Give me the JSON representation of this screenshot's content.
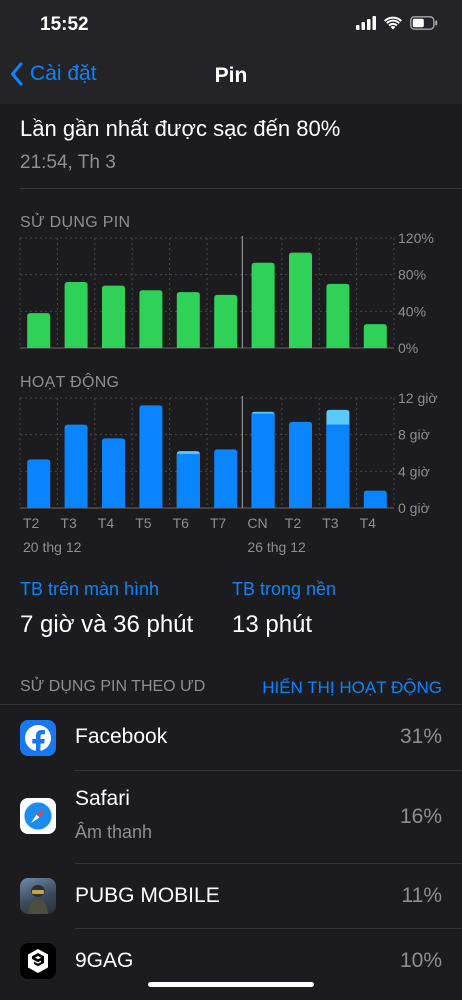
{
  "status_bar": {
    "time": "15:52"
  },
  "nav": {
    "back_label": "Cài đặt",
    "title": "Pin"
  },
  "last_charge": {
    "text": "Lần gần nhất được sạc đến 80%",
    "time": "21:54, Th 3"
  },
  "battery_chart": {
    "label": "SỬ DỤNG PIN",
    "y_ticks": [
      "120%",
      "80%",
      "40%",
      "0%"
    ]
  },
  "activity_chart": {
    "label": "HOẠT ĐỘNG",
    "y_ticks": [
      "12 giờ",
      "8 giờ",
      "4 giờ",
      "0 giờ"
    ]
  },
  "x_axis": {
    "days": [
      "T2",
      "T3",
      "T4",
      "T5",
      "T6",
      "T7",
      "CN",
      "T2",
      "T3",
      "T4"
    ],
    "week_labels": [
      "20 thg 12",
      "26 thg 12"
    ]
  },
  "chart_data": [
    {
      "type": "bar",
      "title": "SỬ DỤNG PIN",
      "categories": [
        "T2",
        "T3",
        "T4",
        "T5",
        "T6",
        "T7",
        "CN",
        "T2",
        "T3",
        "T4"
      ],
      "values": [
        38,
        72,
        68,
        63,
        61,
        58,
        93,
        104,
        70,
        26
      ],
      "ylim": [
        0,
        120
      ],
      "y_unit": "%",
      "color": "#30d158"
    },
    {
      "type": "bar",
      "title": "HOẠT ĐỘNG",
      "categories": [
        "T2",
        "T3",
        "T4",
        "T5",
        "T6",
        "T7",
        "CN",
        "T2",
        "T3",
        "T4"
      ],
      "series": [
        {
          "values": [
            5.3,
            9.1,
            7.6,
            11.2,
            5.9,
            6.4,
            10.3,
            9.4,
            9.1,
            1.9
          ]
        },
        {
          "values": [
            0,
            0,
            0,
            0,
            0.3,
            0,
            0.2,
            0,
            1.6,
            0
          ]
        }
      ],
      "ylim": [
        0,
        12
      ],
      "y_unit": "giờ",
      "colors": [
        "#0a84ff",
        "#5ac8fa"
      ]
    }
  ],
  "screen_time": {
    "label": "TB trên màn hình",
    "value": "7 giờ và 36 phút"
  },
  "background_time": {
    "label": "TB trong nền",
    "value": "13 phút"
  },
  "apps_section": {
    "title": "SỬ DỤNG PIN THEO ƯD",
    "action": "HIỂN THỊ HOẠT ĐỘNG"
  },
  "apps": [
    {
      "name": "Facebook",
      "subtitle": "",
      "percent": "31%",
      "icon": "facebook-icon"
    },
    {
      "name": "Safari",
      "subtitle": "Âm thanh",
      "percent": "16%",
      "icon": "safari-icon"
    },
    {
      "name": "PUBG MOBILE",
      "subtitle": "",
      "percent": "11%",
      "icon": "pubg-icon"
    },
    {
      "name": "9GAG",
      "subtitle": "",
      "percent": "10%",
      "icon": "9gag-icon"
    }
  ]
}
